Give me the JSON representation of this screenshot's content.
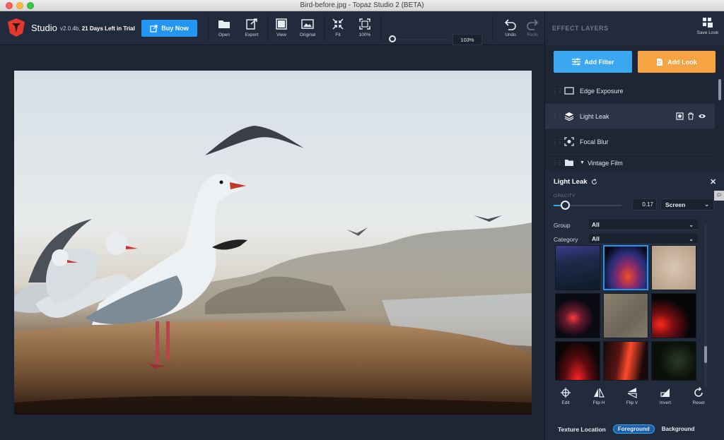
{
  "window": {
    "title": "Bird-before.jpg - Topaz Studio 2 (BETA)"
  },
  "toolbar": {
    "app_name": "Studio",
    "version": "v2.0.4b,",
    "trial": "21 Days Left in Trial",
    "buy_now": "Buy Now",
    "tools": {
      "open": "Open",
      "export": "Export",
      "view": "View",
      "original": "Original",
      "fit": "Fit",
      "zoom100": "100%",
      "undo": "Undo",
      "redo": "Redo"
    },
    "zoom_value": "103%",
    "zoom_slider_fraction": 0.0
  },
  "panel": {
    "title": "EFFECT LAYERS",
    "save_look": "Save Look",
    "add_filter": "Add Filter",
    "add_look": "Add Look",
    "layers": [
      {
        "label": "Edge Exposure",
        "icon": "rectangle-icon",
        "active": false
      },
      {
        "label": "Light Leak",
        "icon": "layers-icon",
        "active": true
      },
      {
        "label": "Focal Blur",
        "icon": "focus-icon",
        "active": false
      },
      {
        "label": "Vintage Film",
        "icon": "folder-icon",
        "active": false
      }
    ]
  },
  "detail": {
    "title": "Light Leak",
    "opacity_label": "OPACITY",
    "opacity_value": "0.17",
    "blend_mode": "Screen",
    "group_label": "Group",
    "group_value": "All",
    "category_label": "Category",
    "category_value": "All",
    "selected_texture_index": 1,
    "tools": {
      "edit": "Edit",
      "flip_h": "Flip H",
      "flip_v": "Flip V",
      "invert": "Invert",
      "reset": "Reset"
    },
    "texture_location_label": "Texture Location",
    "foreground": "Foreground",
    "background": "Background",
    "tooltip": "Cl"
  },
  "colors": {
    "accent_blue": "#2196f3",
    "accent_orange": "#f6a443"
  }
}
